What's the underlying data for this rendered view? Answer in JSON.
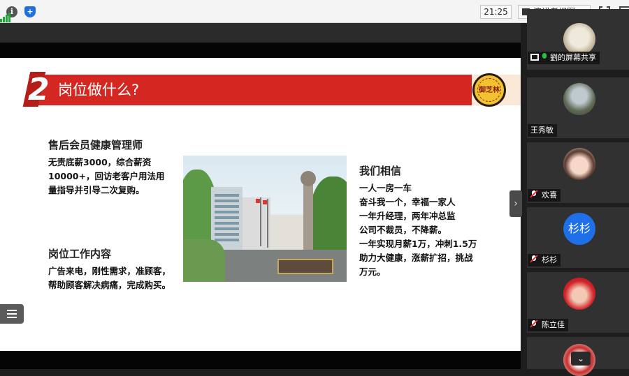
{
  "topbar": {
    "time": "21:25",
    "view_mode": "演讲者视图",
    "icons": [
      "info-icon",
      "shield-icon",
      "signal-icon",
      "fullscreen-icon",
      "window-icon"
    ]
  },
  "slide": {
    "header_title": "岗位做什么?",
    "header_num": "2",
    "logo_text": "御芝林",
    "role_title": "售后会员健康管理师",
    "role_desc": "无责底薪3000，综合薪资10000+，回访老客户用法用量指导并引导二次复购。",
    "duty_title": "岗位工作内容",
    "duty_desc": "广告来电，刚性需求，准顾客，帮助顾客解决病痛，完成购买。",
    "believe_title": "我们相信",
    "believe_lines": [
      "一人一房一车",
      "奋斗我一个，幸福一家人",
      "一年升经理，两年冲总监",
      "公司不裁员，不降薪。",
      "一年实现月薪1万，冲刺1.5万",
      "助力大健康，涨薪扩招，挑战",
      "万元。"
    ],
    "colors": {
      "accent": "#d42722",
      "seal": "#f2c230"
    }
  },
  "participants": [
    {
      "name": "劉的屏幕共享",
      "status": "sharing"
    },
    {
      "name": "王秀敏",
      "status": "none"
    },
    {
      "name": "欢喜",
      "status": "muted"
    },
    {
      "name": "杉杉",
      "status": "muted",
      "initials": "杉杉"
    },
    {
      "name": "陈立佳",
      "status": "muted"
    }
  ]
}
